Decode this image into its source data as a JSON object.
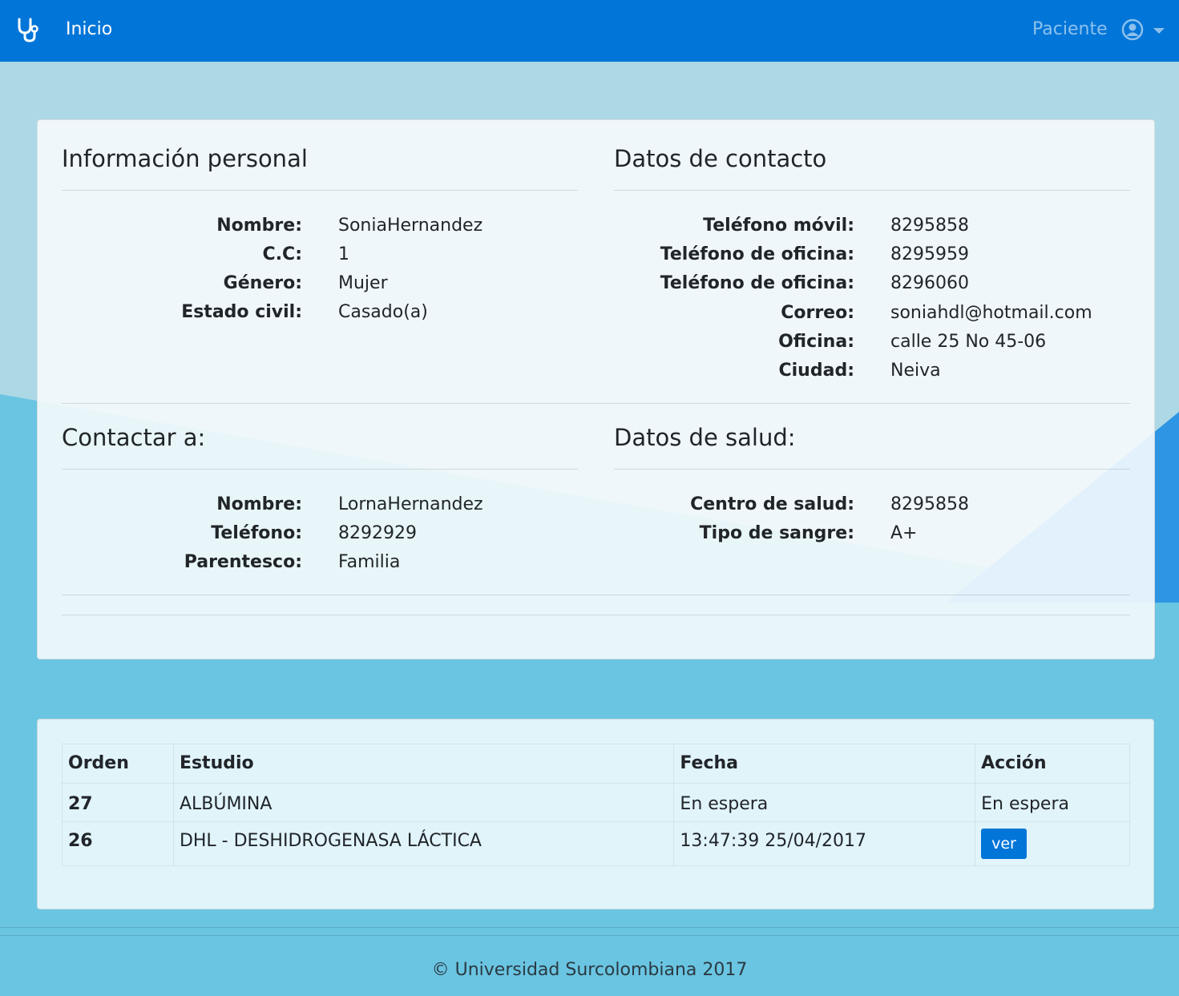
{
  "navbar": {
    "home_label": "Inicio",
    "role_label": "Paciente",
    "brand_icon": "stethoscope-icon",
    "user_icon": "user-circle-icon",
    "background": "#0275d8"
  },
  "personal": {
    "title": "Información personal",
    "fields": [
      {
        "label": "Nombre:",
        "value": "SoniaHernandez"
      },
      {
        "label": "C.C:",
        "value": "1"
      },
      {
        "label": "Género:",
        "value": "Mujer"
      },
      {
        "label": "Estado civil:",
        "value": "Casado(a)"
      }
    ]
  },
  "contact_data": {
    "title": "Datos de contacto",
    "fields": [
      {
        "label": "Teléfono móvil:",
        "value": "8295858"
      },
      {
        "label": "Teléfono de oficina:",
        "value": "8295959"
      },
      {
        "label": "Teléfono de oficina:",
        "value": "8296060"
      },
      {
        "label": "Correo:",
        "value": "soniahdl@hotmail.com"
      },
      {
        "label": "Oficina:",
        "value": "calle 25 No 45-06"
      },
      {
        "label": "Ciudad:",
        "value": "Neiva"
      }
    ]
  },
  "emergency": {
    "title": "Contactar a:",
    "fields": [
      {
        "label": "Nombre:",
        "value": "LornaHernandez"
      },
      {
        "label": "Teléfono:",
        "value": "8292929"
      },
      {
        "label": "Parentesco:",
        "value": "Familia"
      }
    ]
  },
  "health": {
    "title": "Datos de salud:",
    "fields": [
      {
        "label": "Centro de salud:",
        "value": "8295858"
      },
      {
        "label": "Tipo de sangre:",
        "value": "A+"
      }
    ]
  },
  "studies": {
    "headers": [
      "Orden",
      "Estudio",
      "Fecha",
      "Acción"
    ],
    "rows": [
      {
        "orden": "27",
        "estudio": "ALBÚMINA",
        "fecha": "En espera",
        "accion": "En espera"
      },
      {
        "orden": "26",
        "estudio": "DHL - DESHIDROGENASA LÁCTICA",
        "fecha": "13:47:39 25/04/2017",
        "accion_button": "ver"
      }
    ]
  },
  "footer": {
    "text": "© Universidad Surcolombiana 2017"
  }
}
